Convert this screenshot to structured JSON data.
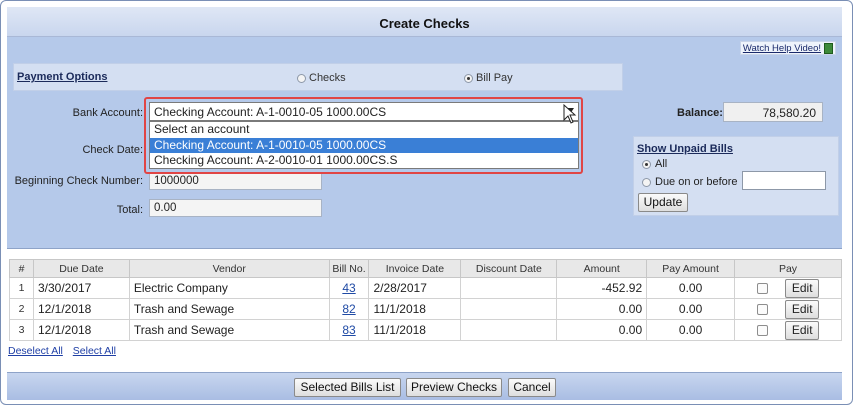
{
  "window": {
    "title": "Create Checks",
    "help_link": "Watch Help Video!"
  },
  "payment_options": {
    "label": "Payment Options",
    "options": [
      {
        "label": "Checks",
        "selected": false
      },
      {
        "label": "Bill Pay",
        "selected": true
      }
    ]
  },
  "form": {
    "bank_account_label": "Bank Account:",
    "bank_account_value": "Checking Account: A-1-0010-05 1000.00CS",
    "bank_account_options": [
      {
        "label": "Select an account",
        "selected": false
      },
      {
        "label": "Checking Account: A-1-0010-05 1000.00CS",
        "selected": true
      },
      {
        "label": "Checking Account: A-2-0010-01 1000.00CS.S",
        "selected": false
      }
    ],
    "check_date_label": "Check Date:",
    "beginning_check_label": "Beginning Check Number:",
    "beginning_check_value": "1000000",
    "total_label": "Total:",
    "total_value": "0.00"
  },
  "balance": {
    "label": "Balance:",
    "value": "78,580.20"
  },
  "unpaid_bills": {
    "title": "Show Unpaid Bills",
    "options": [
      {
        "label": "All",
        "selected": true
      },
      {
        "label": "Due on or before",
        "selected": false
      }
    ],
    "date_value": "",
    "update_label": "Update"
  },
  "table": {
    "columns": [
      "#",
      "Due Date",
      "Vendor",
      "Bill No.",
      "Invoice Date",
      "Discount Date",
      "Amount",
      "Pay Amount",
      "Pay"
    ],
    "rows": [
      {
        "num": "1",
        "due_date": "3/30/2017",
        "vendor": "Electric Company",
        "bill_no": "43",
        "invoice_date": "2/28/2017",
        "discount_date": "",
        "amount": "-452.92",
        "pay_amount": "0.00",
        "edit": "Edit"
      },
      {
        "num": "2",
        "due_date": "12/1/2018",
        "vendor": "Trash and Sewage",
        "bill_no": "82",
        "invoice_date": "11/1/2018",
        "discount_date": "",
        "amount": "0.00",
        "pay_amount": "0.00",
        "edit": "Edit"
      },
      {
        "num": "3",
        "due_date": "12/1/2018",
        "vendor": "Trash and Sewage",
        "bill_no": "83",
        "invoice_date": "11/1/2018",
        "discount_date": "",
        "amount": "0.00",
        "pay_amount": "0.00",
        "edit": "Edit"
      }
    ]
  },
  "links": {
    "deselect_all": "Deselect All",
    "select_all": "Select All"
  },
  "footer": {
    "selected_bills": "Selected Bills List",
    "preview_checks": "Preview Checks",
    "cancel": "Cancel"
  }
}
